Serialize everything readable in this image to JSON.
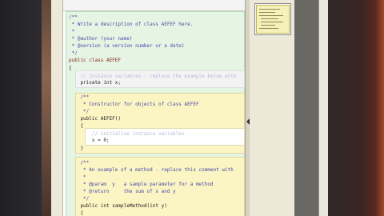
{
  "code_lines": [
    {
      "text": "/**",
      "style": "cmt"
    },
    {
      "text": " * Write a description of class AEFEF here.",
      "style": "cmt"
    },
    {
      "text": " *",
      "style": "cmt"
    },
    {
      "text": " * @author (your name)",
      "style": "cmt"
    },
    {
      "text": " * @version (a version number or a date)",
      "style": "cmt"
    },
    {
      "text": " */",
      "style": "cmt"
    },
    {
      "text": "public class AEFEF",
      "style": "kw"
    },
    {
      "text": "{",
      "style": ""
    },
    {
      "text": "    // instance variables - replace the example below with",
      "style": "cmt-light"
    },
    {
      "text": "    private int x;",
      "style": ""
    },
    {
      "text": "    /**",
      "style": "cmt"
    },
    {
      "text": "     * Constructor for objects of class AEFEF",
      "style": "cmt"
    },
    {
      "text": "     */",
      "style": "cmt"
    },
    {
      "text": "    public AEFEF()",
      "style": ""
    },
    {
      "text": "    {",
      "style": ""
    },
    {
      "text": "        // initialise instance variables",
      "style": "cmt-light"
    },
    {
      "text": "        x = 0;",
      "style": ""
    },
    {
      "text": "    }",
      "style": ""
    },
    {
      "text": "    /**",
      "style": "cmt"
    },
    {
      "text": "     * An example of a method - replace this comment with",
      "style": "cmt"
    },
    {
      "text": "     *",
      "style": "cmt"
    },
    {
      "text": "     * @param  y   a sample parameter for a method",
      "style": "cmt"
    },
    {
      "text": "     * @return     the sum of x and y",
      "style": "cmt"
    },
    {
      "text": "     */",
      "style": "cmt"
    },
    {
      "text": "    public int sampleMethod(int y)",
      "style": ""
    },
    {
      "text": "    {",
      "style": ""
    }
  ],
  "colors": {
    "class_block": "#e4f5e3",
    "method_block": "#fbf5c4",
    "comment_text": "#4a4aa8",
    "keyword_text": "#8a1a1a"
  },
  "icons": {
    "splitter_arrow": "triangle-left"
  }
}
